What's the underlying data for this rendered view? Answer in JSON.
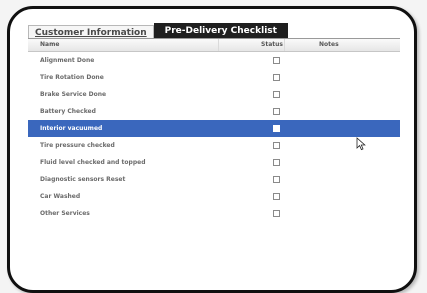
{
  "tabs": [
    {
      "label": "Customer Information",
      "active": false
    },
    {
      "label": "Pre-Delivery Checklist",
      "active": true
    }
  ],
  "columns": {
    "name": "Name",
    "status": "Status",
    "notes": "Notes"
  },
  "rows": [
    {
      "name": "Alignment Done",
      "checked": false,
      "selected": false
    },
    {
      "name": "Tire Rotation Done",
      "checked": false,
      "selected": false
    },
    {
      "name": "Brake Service Done",
      "checked": false,
      "selected": false
    },
    {
      "name": "Battery Checked",
      "checked": false,
      "selected": false
    },
    {
      "name": "Interior vacuumed",
      "checked": false,
      "selected": true
    },
    {
      "name": "Tire pressure checked",
      "checked": false,
      "selected": false
    },
    {
      "name": "Fluid level checked and topped",
      "checked": false,
      "selected": false
    },
    {
      "name": "Diagnostic sensors Reset",
      "checked": false,
      "selected": false
    },
    {
      "name": "Car Washed",
      "checked": false,
      "selected": false
    },
    {
      "name": "Other Services",
      "checked": false,
      "selected": false
    }
  ],
  "colors": {
    "selection": "#3a67bd",
    "active_tab": "#1f1f1f"
  },
  "icons": {
    "cursor": "mouse-pointer-icon"
  }
}
